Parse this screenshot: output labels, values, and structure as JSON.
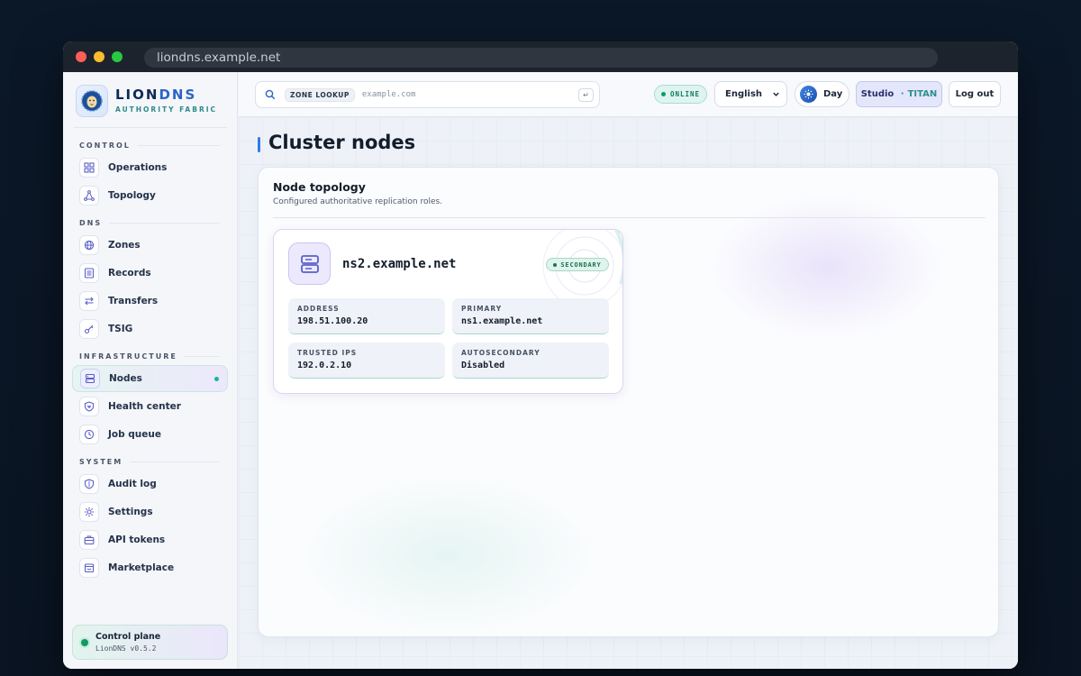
{
  "browser": {
    "url": "liondns.example.net"
  },
  "brand": {
    "name_a": "LION",
    "name_b": "DNS",
    "tagline": "AUTHORITY FABRIC"
  },
  "sidebar": {
    "sections": [
      {
        "title": "CONTROL"
      },
      {
        "title": "DNS"
      },
      {
        "title": "INFRASTRUCTURE"
      },
      {
        "title": "SYSTEM"
      }
    ],
    "items": [
      {
        "label": "Operations",
        "icon": "grid-icon"
      },
      {
        "label": "Topology",
        "icon": "topology-icon"
      },
      {
        "label": "Zones",
        "icon": "globe-icon"
      },
      {
        "label": "Records",
        "icon": "records-icon"
      },
      {
        "label": "Transfers",
        "icon": "transfer-icon"
      },
      {
        "label": "TSIG",
        "icon": "key-icon"
      },
      {
        "label": "Nodes",
        "icon": "server-icon",
        "active": true
      },
      {
        "label": "Health center",
        "icon": "heart-shield-icon"
      },
      {
        "label": "Job queue",
        "icon": "clock-icon"
      },
      {
        "label": "Audit log",
        "icon": "shield-icon"
      },
      {
        "label": "Settings",
        "icon": "gear-icon"
      },
      {
        "label": "API tokens",
        "icon": "briefcase-icon"
      },
      {
        "label": "Marketplace",
        "icon": "store-icon"
      }
    ],
    "footer": {
      "title": "Control plane",
      "version": "LionDNS v0.5.2"
    }
  },
  "topbar": {
    "search": {
      "badge": "ZONE LOOKUP",
      "placeholder": "example.com",
      "enter_glyph": "↵"
    },
    "status": "ONLINE",
    "language": "English",
    "theme": "Day",
    "workspace": {
      "name": "Studio",
      "separator": "·",
      "tenant": "TITAN"
    },
    "logout": "Log out"
  },
  "main": {
    "title": "Cluster nodes",
    "panel": {
      "title": "Node topology",
      "subtitle": "Configured authoritative replication roles.",
      "nodes": [
        {
          "host": "ns2.example.net",
          "role": "SECONDARY",
          "fields": [
            {
              "label": "ADDRESS",
              "value": "198.51.100.20"
            },
            {
              "label": "PRIMARY",
              "value": "ns1.example.net"
            },
            {
              "label": "TRUSTED IPS",
              "value": "192.0.2.10"
            },
            {
              "label": "AUTOSECONDARY",
              "value": "Disabled"
            }
          ]
        }
      ]
    }
  },
  "colors": {
    "accent": "#2f7de0",
    "teal": "#19b3a6",
    "success": "#0e9b6a",
    "indigo": "#5a5fc8"
  }
}
